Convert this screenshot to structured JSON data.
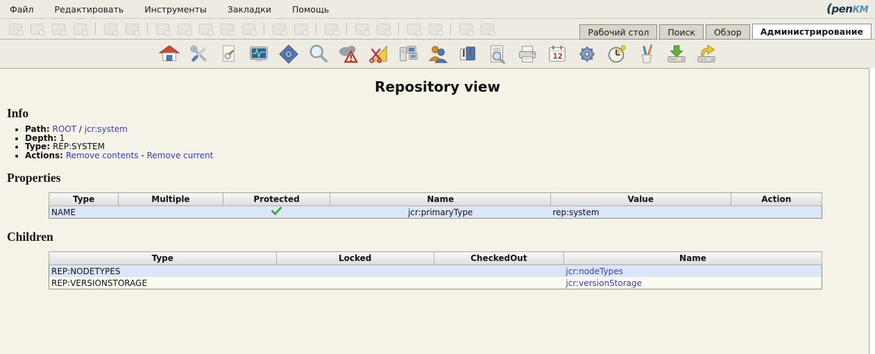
{
  "menubar": {
    "items": [
      "Файл",
      "Редактировать",
      "Инструменты",
      "Закладки",
      "Помощь"
    ]
  },
  "logo": {
    "o": "(",
    "pen": "pen",
    "km": "КМ"
  },
  "tabs": [
    {
      "label": "Рабочий стол",
      "active": false
    },
    {
      "label": "Поиск",
      "active": false
    },
    {
      "label": "Обзор",
      "active": false
    },
    {
      "label": "Администрирование",
      "active": true
    }
  ],
  "toolbar": {
    "disabled_icons": [
      "create-folder-icon",
      "find-document-icon",
      "download-document-icon",
      "download-pdf-icon",
      "lock-icon",
      "unlock-icon",
      "add-document-icon",
      "checkout-document-icon",
      "checkin-document-icon",
      "cancel-checkout-icon",
      "delete-icon",
      "add-property-group-icon",
      "remove-property-group-icon",
      "start-workflow-icon",
      "add-subscription-icon",
      "remove-subscription-icon",
      "refresh-icon",
      "go-home-icon",
      "add-note-icon",
      "remove-note-icon"
    ],
    "groups": [
      4,
      2,
      5,
      2,
      1,
      2,
      2,
      2
    ]
  },
  "admin_toolbar": {
    "icons": [
      "home-icon",
      "tools-icon",
      "script-document-icon",
      "system-monitor-icon",
      "workflow-diamond-icon",
      "search-icon",
      "error-cloud-icon",
      "utilities-scissors-icon",
      "stats-computers-icon",
      "users-icon",
      "profiles-shirts-icon",
      "report-icon",
      "printer-icon",
      "calendar-icon",
      "gear-icon",
      "scheduler-clock-icon",
      "pens-cup-icon",
      "import-drive-icon",
      "export-drive-icon"
    ]
  },
  "main": {
    "title": "Repository view",
    "info": {
      "heading": "Info",
      "path_label": "Path:",
      "path_root": "ROOT",
      "path_sep": " / ",
      "path_node": "jcr:system",
      "depth_label": "Depth:",
      "depth_value": "1",
      "type_label": "Type:",
      "type_value": "REP:SYSTEM",
      "actions_label": "Actions:",
      "action_remove_contents": "Remove contents",
      "action_sep": " - ",
      "action_remove_current": "Remove current"
    },
    "properties": {
      "heading": "Properties",
      "columns": [
        "Type",
        "Multiple",
        "Protected",
        "Name",
        "Value",
        "Action"
      ],
      "rows": [
        {
          "type": "NAME",
          "multiple": "",
          "protected": true,
          "name": "jcr:primaryType",
          "value": "rep:system",
          "action": ""
        }
      ]
    },
    "children": {
      "heading": "Children",
      "columns": [
        "Type",
        "Locked",
        "CheckedOut",
        "Name"
      ],
      "rows": [
        {
          "type": "REP:NODETYPES",
          "locked": "",
          "checkedout": "",
          "name": "jcr:nodeTypes"
        },
        {
          "type": "REP:VERSIONSTORAGE",
          "locked": "",
          "checkedout": "",
          "name": "jcr:versionStorage"
        }
      ]
    }
  },
  "colors": {
    "link": "#3A3AC8",
    "row_highlight": "#DBE6F8",
    "check_green": "#44A044",
    "content_bg": "#F5F3E8",
    "bar_bg": "#EDEBE2"
  }
}
